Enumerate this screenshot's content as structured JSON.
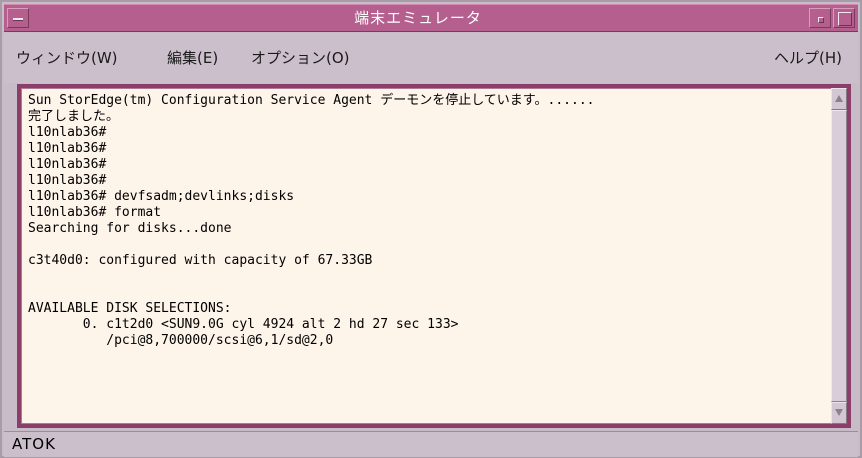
{
  "window": {
    "title": "端末エミュレータ"
  },
  "menubar": {
    "items": [
      {
        "label": "ウィンドウ(W)"
      },
      {
        "label": "編集(E)"
      },
      {
        "label": "オプション(O)"
      }
    ],
    "help_label": "ヘルプ(H)"
  },
  "terminal": {
    "lines": [
      "Sun StorEdge(tm) Configuration Service Agent デーモンを停止しています。......",
      "完了しました。",
      "l10nlab36#",
      "l10nlab36#",
      "l10nlab36#",
      "l10nlab36#",
      "l10nlab36# devfsadm;devlinks;disks",
      "l10nlab36# format",
      "Searching for disks...done",
      "",
      "c3t40d0: configured with capacity of 67.33GB",
      "",
      "",
      "AVAILABLE DISK SELECTIONS:",
      "       0. c1t2d0 <SUN9.0G cyl 4924 alt 2 hd 27 sec 133>",
      "          /pci@8,700000/scsi@6,1/sd@2,0"
    ]
  },
  "statusbar": {
    "text": "ATOK"
  },
  "icons": {
    "window_menu": "window-menu-icon",
    "minimize": "minimize-icon",
    "maximize": "maximize-icon",
    "scroll_up": "arrow-up-icon",
    "scroll_down": "arrow-down-icon"
  },
  "colors": {
    "titlebar": "#b55f8f",
    "terminal_bg": "#fdf4ea",
    "terminal_border": "#8a3e68",
    "chrome": "#cbbfcb"
  }
}
